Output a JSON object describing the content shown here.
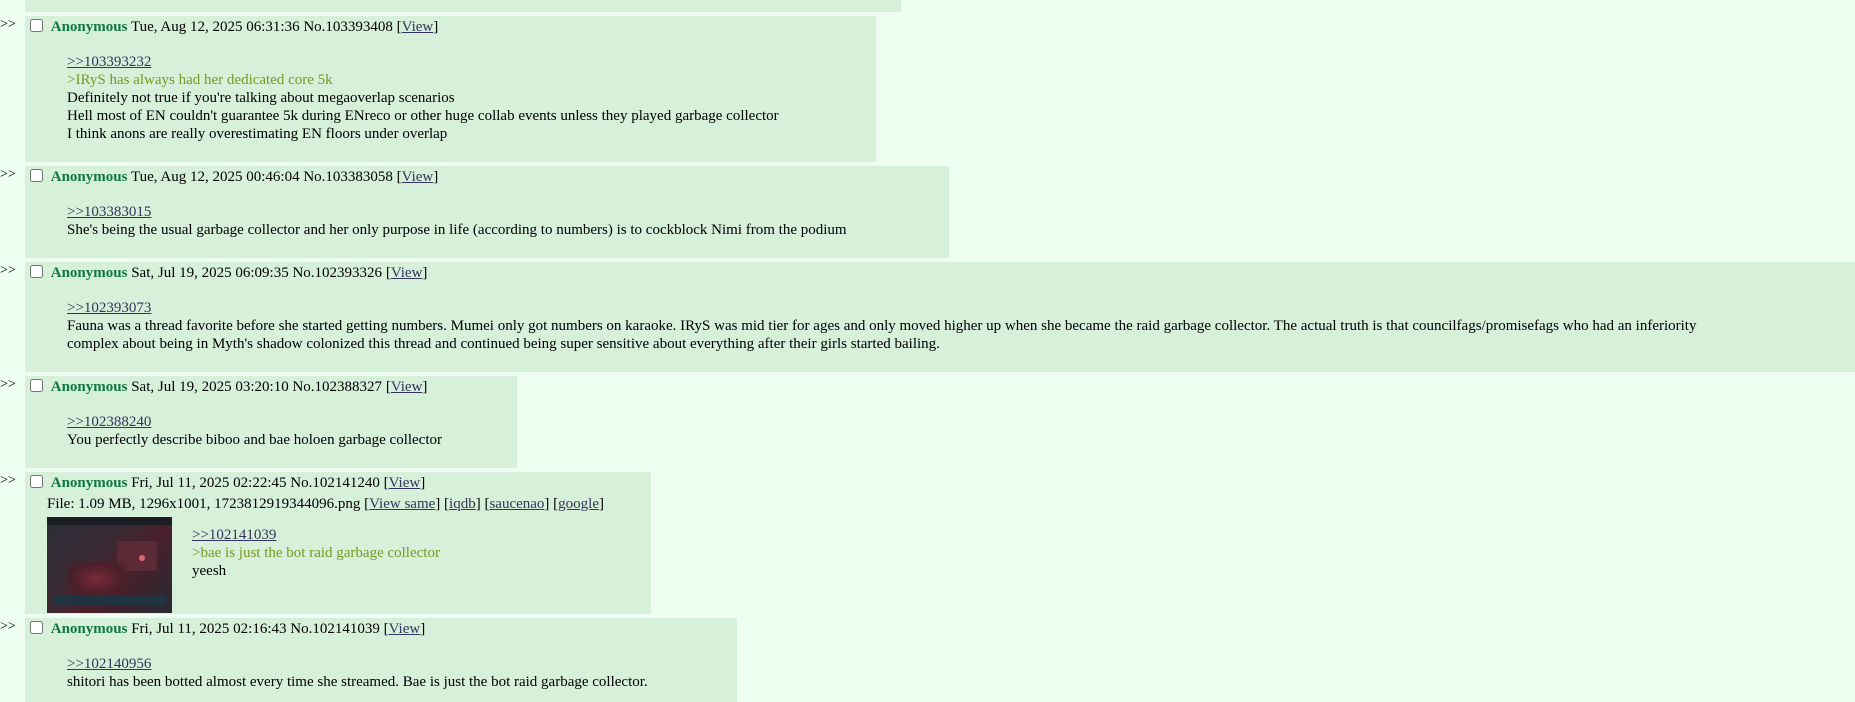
{
  "posts": [
    {
      "arrows": ">>",
      "name": "Anonymous",
      "date": "Tue, Aug 12, 2025 06:31:36",
      "number": "No.103393408",
      "view": "View",
      "quote": ">>103393232",
      "greentext": [
        ">IRyS has always had her dedicated core 5k"
      ],
      "lines": [
        "Definitely not true if you're talking about megaoverlap scenarios",
        "Hell most of EN couldn't guarantee 5k during ENreco or other huge collab events unless they played garbage collector",
        "I think anons are really overestimating EN floors under overlap"
      ]
    },
    {
      "arrows": ">>",
      "name": "Anonymous",
      "date": "Tue, Aug 12, 2025 00:46:04",
      "number": "No.103383058",
      "view": "View",
      "quote": ">>103383015",
      "lines": [
        "She's being the usual garbage collector and her only purpose in life (according to numbers) is to cockblock Nimi from the podium"
      ]
    },
    {
      "arrows": ">>",
      "name": "Anonymous",
      "date": "Sat, Jul 19, 2025 06:09:35",
      "number": "No.102393326",
      "view": "View",
      "quote": ">>102393073",
      "lines": [
        "Fauna was a thread favorite before she started getting numbers. Mumei only got numbers on karaoke. IRyS was mid tier for ages and only moved higher up when she became the raid garbage collector. The actual truth is that councilfags/promisefags who had an inferiority",
        "complex about being in Myth's shadow colonized this thread and continued being super sensitive about everything after their girls started bailing."
      ]
    },
    {
      "arrows": ">>",
      "name": "Anonymous",
      "date": "Sat, Jul 19, 2025 03:20:10",
      "number": "No.102388327",
      "view": "View",
      "quote": ">>102388240",
      "lines": [
        "You perfectly describe biboo and bae holoen garbage collector"
      ]
    },
    {
      "arrows": ">>",
      "name": "Anonymous",
      "date": "Fri, Jul 11, 2025 02:22:45",
      "number": "No.102141240",
      "view": "View",
      "file": {
        "prefix": "File: 1.09 MB, 1296x1001, 1723812919344096.png",
        "view_same": "View same",
        "iqdb": "iqdb",
        "saucenao": "saucenao",
        "google": "google"
      },
      "quote": ">>102141039",
      "greentext": [
        ">bae is just the bot raid garbage collector"
      ],
      "lines": [
        "yeesh"
      ]
    },
    {
      "arrows": ">>",
      "name": "Anonymous",
      "date": "Fri, Jul 11, 2025 02:16:43",
      "number": "No.102141039",
      "view": "View",
      "quote": ">>102140956",
      "lines": [
        "shitori has been botted almost every time she streamed. Bae is just the bot raid garbage collector."
      ]
    }
  ],
  "colors": {
    "background": "#eefff2",
    "post_bg": "#d6f0da",
    "name": "#117743",
    "link": "#34345c",
    "greentext": "#789922"
  }
}
